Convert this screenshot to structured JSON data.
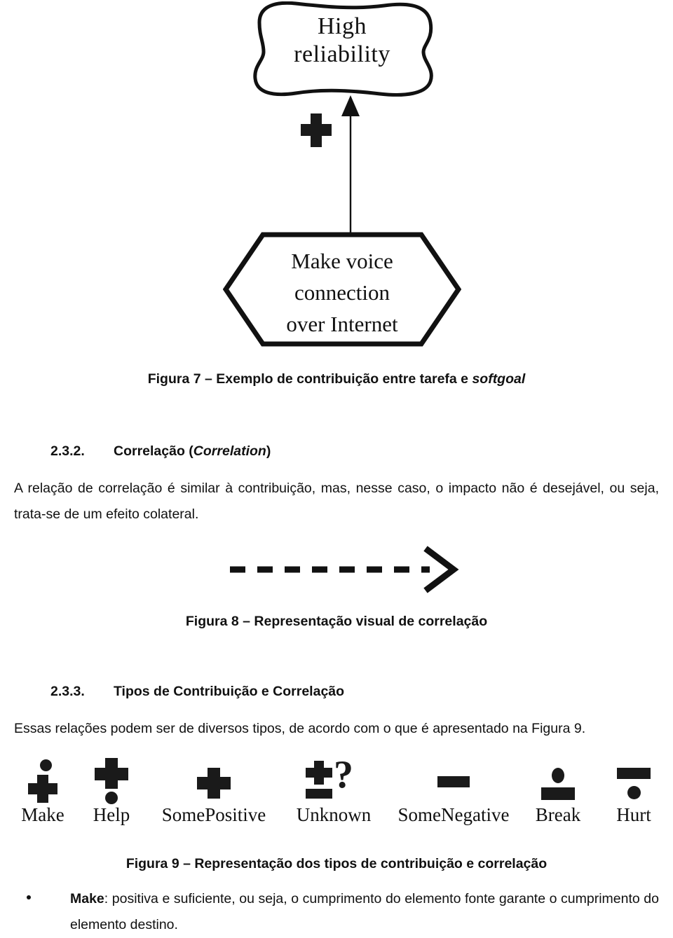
{
  "figure7": {
    "softgoal_label_line1": "High",
    "softgoal_label_line2": "reliability",
    "contribution_symbol": "+",
    "task_label_line1": "Make voice",
    "task_label_line2": "connection",
    "task_label_line3": "over Internet",
    "caption": "Figura 7 – Exemplo de contribuição entre tarefa e ",
    "caption_italic": "softgoal"
  },
  "section_232": {
    "number": "2.3.2.",
    "title_plain": "Correlação (",
    "title_italic": "Correlation",
    "title_tail": ")",
    "paragraph": "A relação de correlação é similar à contribuição, mas, nesse caso, o impacto não é desejável, ou seja, trata-se de um efeito colateral."
  },
  "figure8": {
    "caption": "Figura 8 – Representação visual de correlação"
  },
  "section_233": {
    "number": "2.3.3.",
    "title": "Tipos de Contribuição e Correlação",
    "paragraph": "Essas relações podem ser de diversos tipos, de acordo com o que é apresentado na Figura 9."
  },
  "figure9": {
    "caption": "Figura 9 – Representação dos tipos de contribuição e correlação",
    "icons": [
      {
        "label": "Make",
        "glyph": "dot-over-plus"
      },
      {
        "label": "Help",
        "glyph": "plus-over-dot"
      },
      {
        "label": "SomePositive",
        "glyph": "plus"
      },
      {
        "label": "Unknown",
        "glyph": "plus-minus-question"
      },
      {
        "label": "SomeNegative",
        "glyph": "minus"
      },
      {
        "label": "Break",
        "glyph": "dot-over-minus"
      },
      {
        "label": "Hurt",
        "glyph": "minus-over-dot"
      }
    ]
  },
  "bullets": [
    {
      "term": "Make",
      "separator": ": ",
      "text": "positiva e suficiente, ou seja, o cumprimento do elemento fonte garante o cumprimento do elemento destino."
    }
  ],
  "colors": {
    "ink": "#111111",
    "diagram_stroke": "#1a1a1a",
    "page_background": "#ffffff"
  }
}
